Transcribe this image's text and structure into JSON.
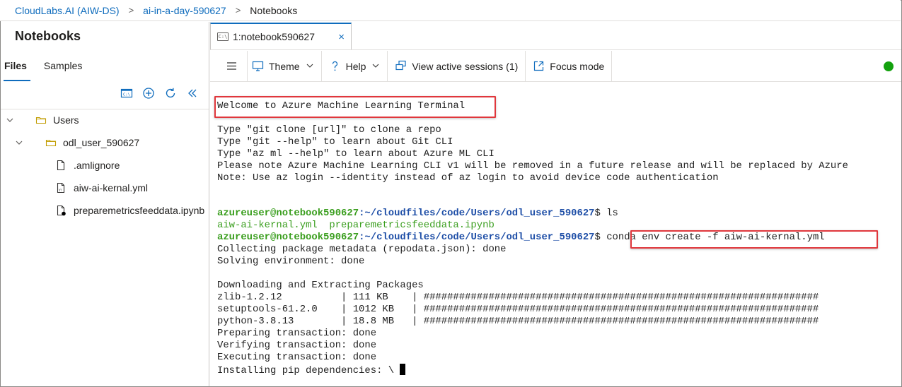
{
  "breadcrumb": {
    "items": [
      "CloudLabs.AI (AIW-DS)",
      "ai-in-a-day-590627",
      "Notebooks"
    ],
    "separator": ">"
  },
  "sidebar": {
    "title": "Notebooks",
    "tabs": [
      "Files",
      "Samples"
    ],
    "active_tab": "Files",
    "tools": [
      "terminal-icon",
      "add-icon",
      "refresh-icon",
      "collapse-icon"
    ],
    "tree": [
      {
        "label": "Users",
        "type": "folder"
      },
      {
        "label": "odl_user_590627",
        "type": "folder"
      },
      {
        "label": ".amlignore",
        "type": "file"
      },
      {
        "label": "aiw-ai-kernal.yml",
        "type": "yml"
      },
      {
        "label": "preparemetricsfeeddata.ipynb",
        "type": "notebook"
      }
    ]
  },
  "doc_tab": {
    "icon_text": "C:\\",
    "label": "1:notebook590627",
    "close": "×"
  },
  "toolbar": {
    "theme": "Theme",
    "help": "Help",
    "sessions": "View active sessions (1)",
    "focus": "Focus mode",
    "status_color": "#13a10e"
  },
  "terminal": {
    "welcome": "Welcome to Azure Machine Learning Terminal",
    "info": [
      "Type \"git clone [url]\" to clone a repo",
      "Type \"git --help\" to learn about Git CLI",
      "Type \"az ml --help\" to learn about Azure ML CLI",
      "Please note Azure Machine Learning CLI v1 will be removed in a future release and will be replaced by Azure",
      "Note: Use az login --identity instead of az login to avoid device code authentication"
    ],
    "prompt_user": "azureuser@notebook590627",
    "prompt_path": ":~/cloudfiles/code/Users/odl_user_590627",
    "prompt_end": "$",
    "cmd_ls": " ls",
    "ls_output": "aiw-ai-kernal.yml  preparemetricsfeeddata.ipynb",
    "cmd_conda": "conda env create -f aiw-ai-kernal.yml",
    "output": [
      "Collecting package metadata (repodata.json): done",
      "Solving environment: done",
      "",
      "Downloading and Extracting Packages",
      "zlib-1.2.12          | 111 KB    | ###################################################################",
      "setuptools-61.2.0    | 1012 KB   | ###################################################################",
      "python-3.8.13        | 18.8 MB   | ###################################################################",
      "Preparing transaction: done",
      "Verifying transaction: done",
      "Executing transaction: done",
      "Installing pip dependencies: \\ "
    ]
  },
  "highlight_color": "#e0373c"
}
